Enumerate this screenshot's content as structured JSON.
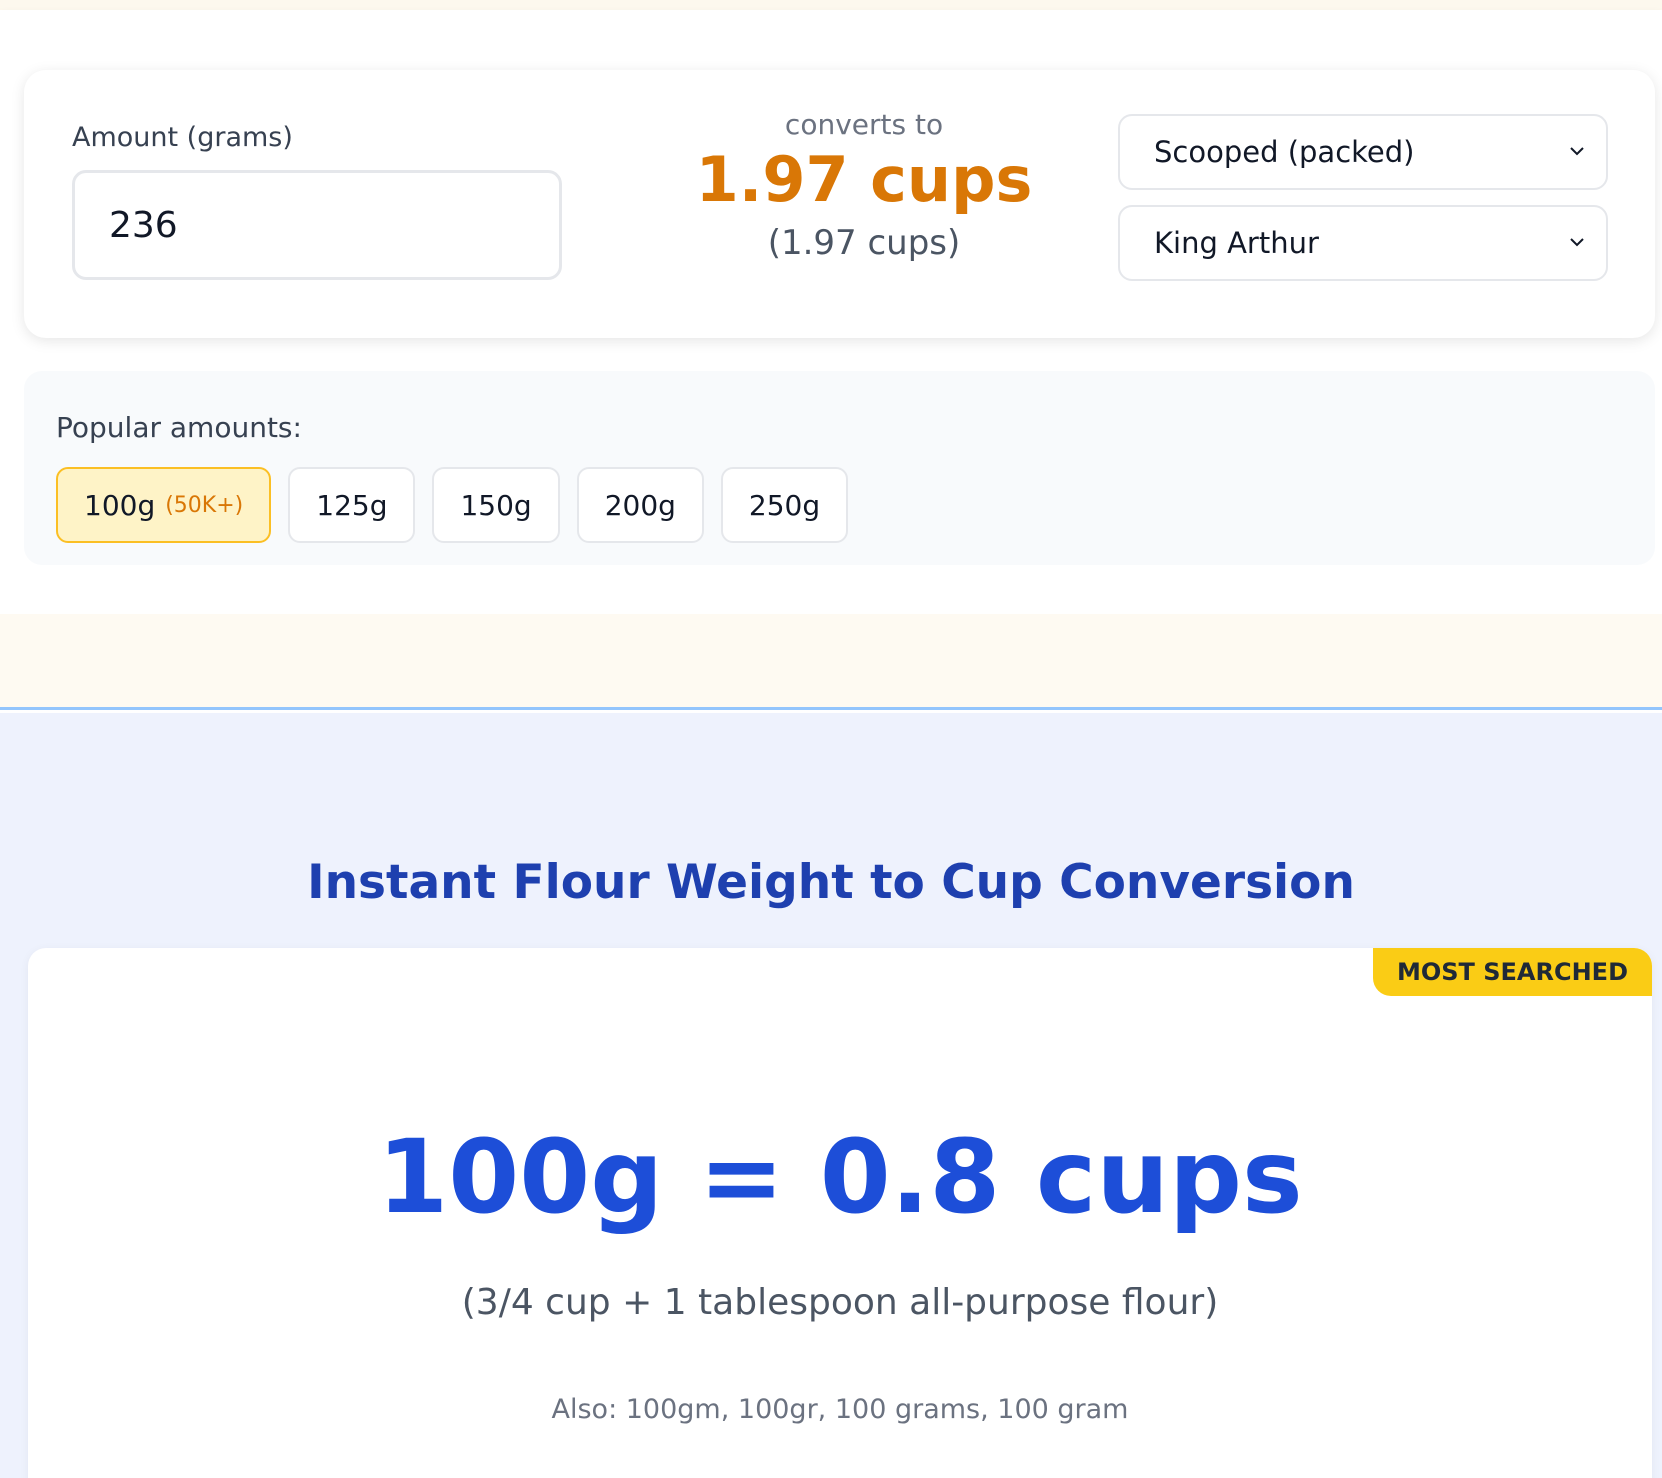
{
  "converter": {
    "amount_label": "Amount (grams)",
    "amount_value": "236",
    "converts_to": "converts to",
    "result_main": "1.97 cups",
    "result_sub": "(1.97 cups)",
    "method_select": "Scooped (packed)",
    "brand_select": "King Arthur"
  },
  "popular": {
    "label": "Popular amounts:",
    "chips": [
      {
        "label": "100g",
        "badge": "(50K+)"
      },
      {
        "label": "125g"
      },
      {
        "label": "150g"
      },
      {
        "label": "200g"
      },
      {
        "label": "250g"
      }
    ]
  },
  "section": {
    "title": "Instant Flour Weight to Cup Conversion"
  },
  "highlight": {
    "badge": "MOST SEARCHED",
    "equation": "100g = 0.8 cups",
    "equivalent": "(3/4 cup + 1 tablespoon all-purpose flour)",
    "also": "Also: 100gm, 100gr, 100 grams, 100 gram"
  },
  "colors": {
    "accent_orange": "#d97706",
    "accent_blue": "#1d4ed8",
    "title_blue": "#1e40af",
    "badge_yellow": "#facc15"
  },
  "icons": {
    "select_chevron": "chevron-down-icon"
  }
}
